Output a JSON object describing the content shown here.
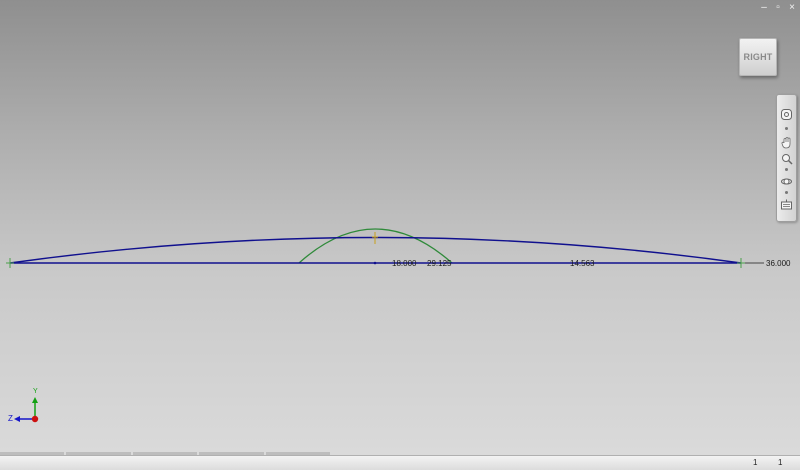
{
  "window": {
    "minimize": "–",
    "restore": "▫",
    "close": "×"
  },
  "viewcube": {
    "face": "RIGHT"
  },
  "navbar": {
    "tools": [
      {
        "name": "full-navigation-wheel",
        "icon": "steering-wheel-icon"
      },
      {
        "name": "pan",
        "icon": "hand-icon"
      },
      {
        "name": "zoom",
        "icon": "magnifier-icon"
      },
      {
        "name": "orbit",
        "icon": "orbit-icon"
      },
      {
        "name": "look-at",
        "icon": "look-at-icon"
      }
    ]
  },
  "sketch": {
    "dimensions": {
      "d1": "18.000",
      "d2": "29.125",
      "d3": "14.563",
      "d4": "36.000"
    },
    "colors": {
      "line": "#10108e",
      "arc": "#2f8a3a",
      "origin": "#c8a019"
    }
  },
  "triad": {
    "y_label": "Y",
    "z_label": "Z",
    "colors": {
      "y": "#12a012",
      "z": "#1515c8",
      "x": "#cc1010"
    }
  },
  "status": {
    "value1": "1",
    "value2": "1"
  }
}
